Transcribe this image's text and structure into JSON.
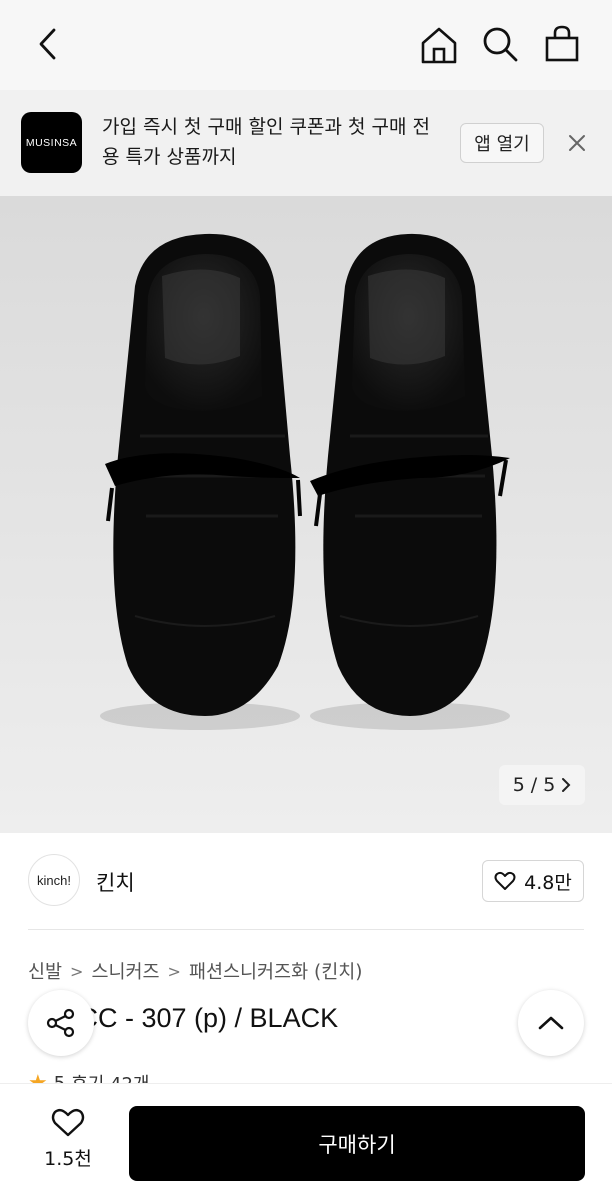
{
  "banner": {
    "logo_text": "MUSINSA",
    "message": "가입 즉시 첫 구매 할인 쿠폰과 첫 구매 전용 특가 상품까지",
    "open_app_label": "앱 열기"
  },
  "gallery": {
    "current": "5",
    "separator": "/",
    "total": "5"
  },
  "brand": {
    "logo_text": "kinch!",
    "name": "킨치",
    "likes": "4.8만"
  },
  "breadcrumb": {
    "items": [
      "신발",
      "스니커즈",
      "패션스니커즈화 (킨치)"
    ]
  },
  "product": {
    "title": "STACC - 307 (p) / BLACK",
    "rating": "5",
    "reviews": "후기 42개"
  },
  "bottom_bar": {
    "like_count": "1.5천",
    "buy_label": "구매하기"
  },
  "colors": {
    "accent_star": "#f5a623",
    "buy_button": "#000000"
  },
  "icons": [
    "chevron-left-icon",
    "home-icon",
    "search-icon",
    "shopping-bag-icon",
    "close-icon",
    "chevron-right-icon",
    "heart-icon",
    "share-icon",
    "chevron-up-icon",
    "star-icon"
  ]
}
